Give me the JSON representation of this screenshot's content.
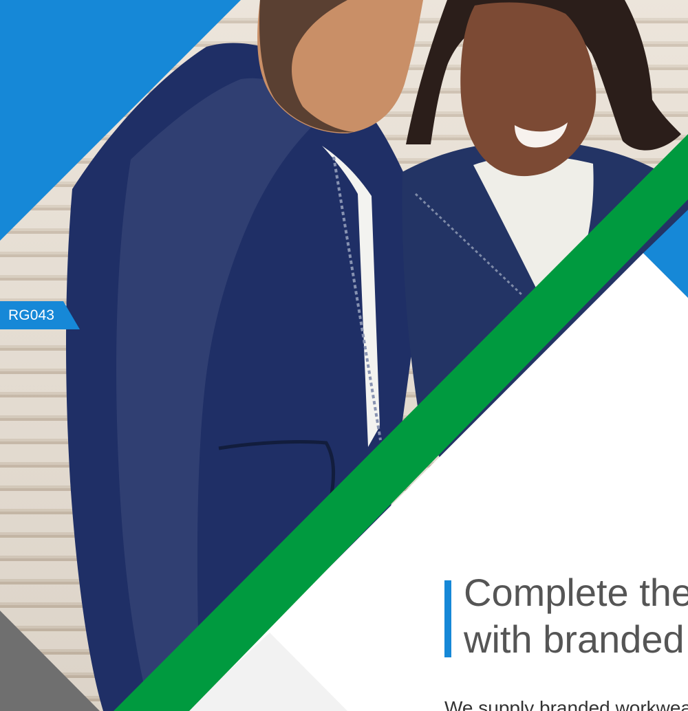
{
  "page": {
    "product_code": "RG043",
    "headline_lines": [
      "Complete the",
      "with branded"
    ],
    "body_partial": "We supply branded workwear"
  },
  "colors": {
    "blue": "#1688d7",
    "green": "#009a3f",
    "gray": "#6f6f6f",
    "white": "#ffffff",
    "navy_jacket": "#1f2f66",
    "skin_tone_1": "#c98f67",
    "skin_tone_2": "#7c4a34",
    "stone": "#ddd2c5",
    "text_gray": "#555555"
  },
  "icons": {
    "zipper": "zipper-icon"
  }
}
